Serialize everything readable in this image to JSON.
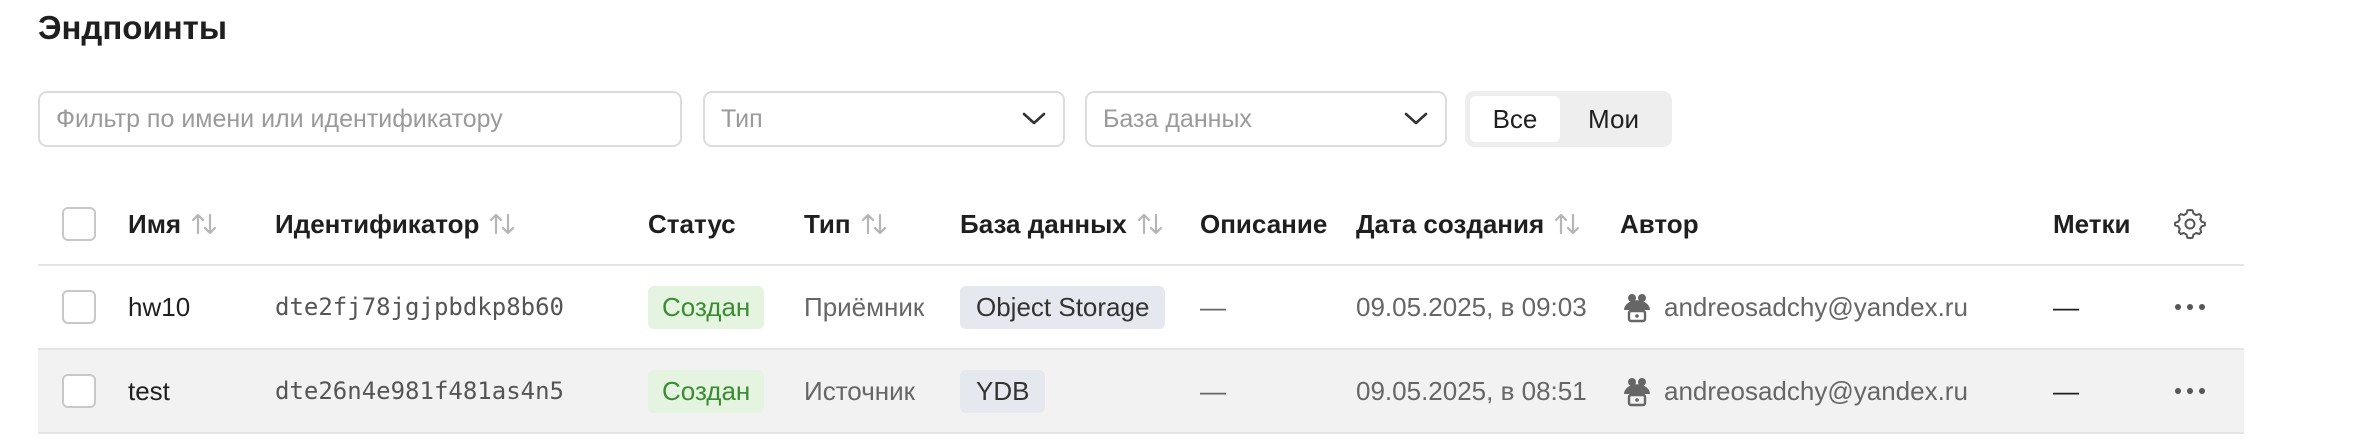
{
  "page": {
    "title": "Эндпоинты"
  },
  "filters": {
    "search_placeholder": "Фильтр по имени или идентификатору",
    "type_placeholder": "Тип",
    "database_placeholder": "База данных",
    "segment": {
      "all": "Все",
      "mine": "Мои",
      "selected": "Все"
    }
  },
  "table": {
    "headers": {
      "name": "Имя",
      "id": "Идентификатор",
      "status": "Статус",
      "type": "Тип",
      "database": "База данных",
      "description": "Описание",
      "created": "Дата создания",
      "author": "Автор",
      "tags": "Метки"
    },
    "rows": [
      {
        "name": "hw10",
        "id": "dte2fj78jgjpbdkp8b60",
        "status": "Создан",
        "type": "Приёмник",
        "database": "Object Storage",
        "description": "—",
        "created": "09.05.2025, в 09:03",
        "author": "andreosadchy@yandex.ru",
        "tags": "—"
      },
      {
        "name": "test",
        "id": "dte26n4e981f481as4n5",
        "status": "Создан",
        "type": "Источник",
        "database": "YDB",
        "description": "—",
        "created": "09.05.2025, в 08:51",
        "author": "andreosadchy@yandex.ru",
        "tags": "—"
      }
    ]
  },
  "icons": {
    "chevron": "chevron-down-icon",
    "sort": "sort-arrows-icon",
    "settings": "gear-icon",
    "author": "service-account-icon",
    "more": "more-horizontal-icon"
  },
  "colors": {
    "status_created_bg": "#e4f4e1",
    "status_created_text": "#3a8d2f",
    "db_badge_bg": "#e5e8ee",
    "row_hover_bg": "#f2f2f2"
  }
}
